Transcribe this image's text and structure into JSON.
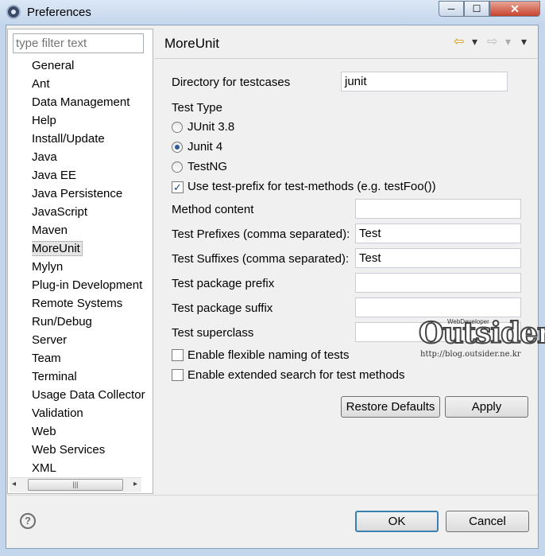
{
  "window": {
    "title": "Preferences",
    "minimize_glyph": "─",
    "maximize_glyph": "☐",
    "close_glyph": "✕"
  },
  "sidebar": {
    "filter_placeholder": "type filter text",
    "items": [
      "General",
      "Ant",
      "Data Management",
      "Help",
      "Install/Update",
      "Java",
      "Java EE",
      "Java Persistence",
      "JavaScript",
      "Maven",
      "MoreUnit",
      "Mylyn",
      "Plug-in Development",
      "Remote Systems",
      "Run/Debug",
      "Server",
      "Team",
      "Terminal",
      "Usage Data Collector",
      "Validation",
      "Web",
      "Web Services",
      "XML"
    ],
    "selected": "MoreUnit",
    "scroll_left": "◂",
    "scroll_right": "▸",
    "scroll_grip": "|||"
  },
  "page": {
    "title": "MoreUnit",
    "nav": {
      "back": "⇦",
      "back_menu": "▾",
      "forward": "⇨",
      "forward_menu": "▾",
      "view_menu": "▾"
    },
    "directory_label": "Directory for testcases",
    "directory_value": "junit",
    "test_type_label": "Test Type",
    "radio_junit38": "JUnit 3.8",
    "radio_junit4": "Junit 4",
    "radio_testng": "TestNG",
    "selected_test_type": "Junit 4",
    "use_prefix_label": "Use test-prefix for test-methods (e.g. testFoo())",
    "use_prefix_checked": true,
    "method_content_label": "Method content",
    "method_content_value": "",
    "test_prefixes_label": "Test Prefixes (comma separated):",
    "test_prefixes_value": "Test",
    "test_suffixes_label": "Test Suffixes (comma separated):",
    "test_suffixes_value": "Test",
    "package_prefix_label": "Test package prefix",
    "package_prefix_value": "",
    "package_suffix_label": "Test package suffix",
    "package_suffix_value": "",
    "superclass_label": "Test superclass",
    "superclass_value": "",
    "flexible_naming_label": "Enable flexible naming of tests",
    "flexible_naming_checked": false,
    "extended_search_label": "Enable extended search for test methods",
    "extended_search_checked": false,
    "restore_defaults": "Restore Defaults",
    "apply": "Apply"
  },
  "footer": {
    "help_glyph": "?",
    "ok": "OK",
    "cancel": "Cancel"
  },
  "watermark": {
    "brand": "Outsider",
    "tagline": "WebDeveloper",
    "url": "http://blog.outsider.ne.kr"
  }
}
